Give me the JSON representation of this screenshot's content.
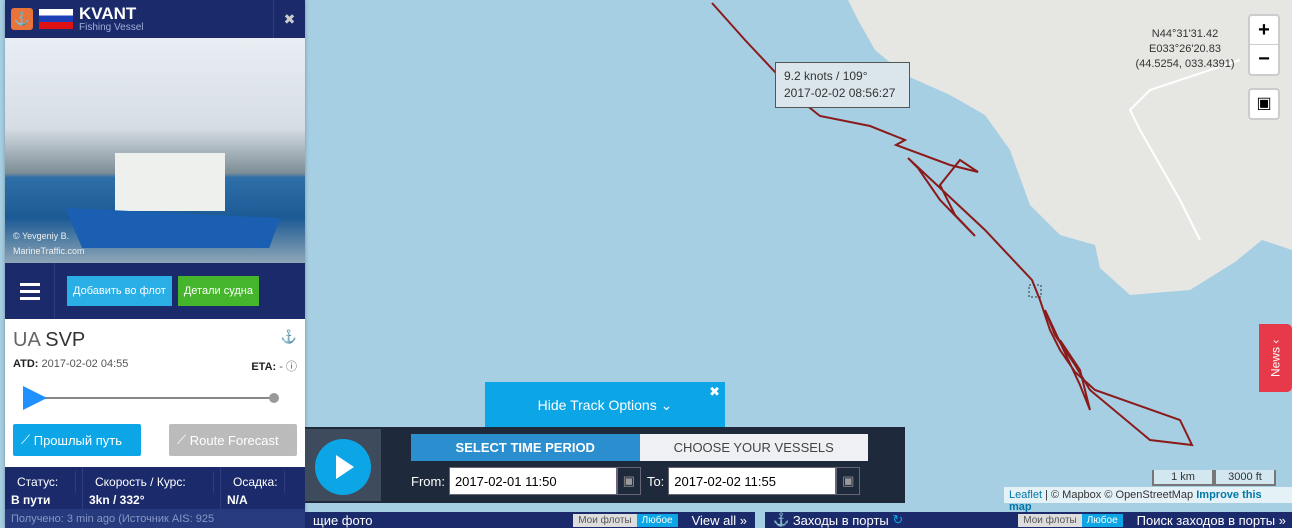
{
  "vessel": {
    "name": "KVANT",
    "type": "Fishing Vessel",
    "flag": "Russia",
    "photo_credit": "© Yevgeniy B.",
    "photo_site": "MarineTraffic.com"
  },
  "actions": {
    "add_fleet": "Добавить во флот",
    "details": "Детали судна"
  },
  "voyage": {
    "country": "UA",
    "port": "SVP",
    "atd_label": "ATD:",
    "atd": "2017-02-02 04:55",
    "eta_label": "ETA:",
    "eta": "-",
    "progress": 0
  },
  "buttons": {
    "past_track": "Прошлый путь",
    "route_forecast": "Route Forecast"
  },
  "stats": {
    "status_label": "Статус:",
    "status": "В пути",
    "speed_label": "Скорость / Курс:",
    "speed": "3kn / 332°",
    "draught_label": "Осадка:",
    "draught": "N/A"
  },
  "received": "Получено: 3 min ago (Источник AIS: 925",
  "map": {
    "coord_lat": "N44°31'31.42",
    "coord_lon": "E033°26'20.83",
    "coord_dec": "(44.5254, 033.4391)",
    "zoom_in": "+",
    "zoom_out": "−",
    "tooltip_speed": "9.2 knots / 109°",
    "tooltip_time": "2017-02-02 08:56:27",
    "scale_km": "1 km",
    "scale_ft": "3000 ft",
    "attr_leaflet": "Leaflet",
    "attr_mapbox": " | © Mapbox © OpenStreetMap ",
    "attr_improve": "Improve this map",
    "news": "News",
    "track_color": "#8b1a1a"
  },
  "track": {
    "hide": "Hide Track Options",
    "tab_time": "SELECT TIME PERIOD",
    "tab_vessels": "CHOOSE YOUR VESSELS",
    "from_label": "From:",
    "from": "2017-02-01 11:50",
    "to_label": "To:",
    "to": "2017-02-02 11:55"
  },
  "bottom": {
    "photos": "щие фото",
    "my_fleets": "Мои флоты",
    "any": "Любое",
    "view_all": "View all »",
    "port_calls": "Заходы в порты",
    "search_calls": "Поиск заходов в порты »"
  }
}
